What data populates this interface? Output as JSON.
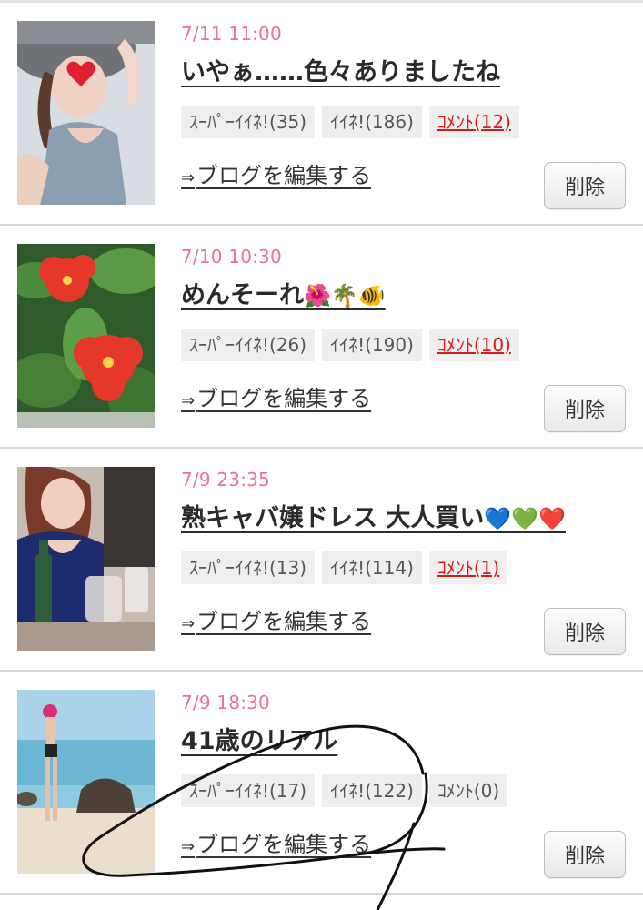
{
  "posts": [
    {
      "date": "7/11 11:00",
      "title": "いやぁ……色々ありましたね",
      "title_emoji": "",
      "super_like": "ｽｰﾊﾟｰｲｲﾈ!(35)",
      "like": "ｲｲﾈ!(186)",
      "comment": "ｺﾒﾝﾄ(12)",
      "comment_active": true,
      "edit_link": "ブログを編集する",
      "delete": "削除",
      "thumb_icon": "woman-with-hat-photo",
      "colors": {
        "bg": "#cfd6de",
        "accent": "#e02030"
      }
    },
    {
      "date": "7/10 10:30",
      "title": "めんそーれ",
      "title_emoji": "🌺🌴🐠",
      "super_like": "ｽｰﾊﾟｰｲｲﾈ!(26)",
      "like": "ｲｲﾈ!(190)",
      "comment": "ｺﾒﾝﾄ(10)",
      "comment_active": true,
      "edit_link": "ブログを編集する",
      "delete": "削除",
      "thumb_icon": "hibiscus-photo",
      "colors": {
        "bg": "#3f7a3a",
        "accent": "#e2382c"
      }
    },
    {
      "date": "7/9 23:35",
      "title": "熟キャバ嬢ドレス 大人買い",
      "title_emoji": "💙💚❤️",
      "super_like": "ｽｰﾊﾟｰｲｲﾈ!(13)",
      "like": "ｲｲﾈ!(114)",
      "comment": "ｺﾒﾝﾄ(1)",
      "comment_active": true,
      "edit_link": "ブログを編集する",
      "delete": "削除",
      "thumb_icon": "woman-with-drinks-photo",
      "colors": {
        "bg": "#b9a89a",
        "accent": "#1c2b6a"
      }
    },
    {
      "date": "7/9 18:30",
      "title": "41歳のリアル",
      "title_emoji": "",
      "super_like": "ｽｰﾊﾟｰｲｲﾈ!(17)",
      "like": "ｲｲﾈ!(122)",
      "comment": "ｺﾒﾝﾄ(0)",
      "comment_active": false,
      "edit_link": "ブログを編集する",
      "delete": "削除",
      "thumb_icon": "beach-photo",
      "colors": {
        "bg": "#7fc2dd",
        "accent": "#e8dcc4"
      }
    }
  ],
  "edit_arrow": "⇒",
  "colors": {
    "date_pink": "#ee6fa0",
    "comment_red": "#d21b1b",
    "badge_gray": "#eeeeee"
  }
}
